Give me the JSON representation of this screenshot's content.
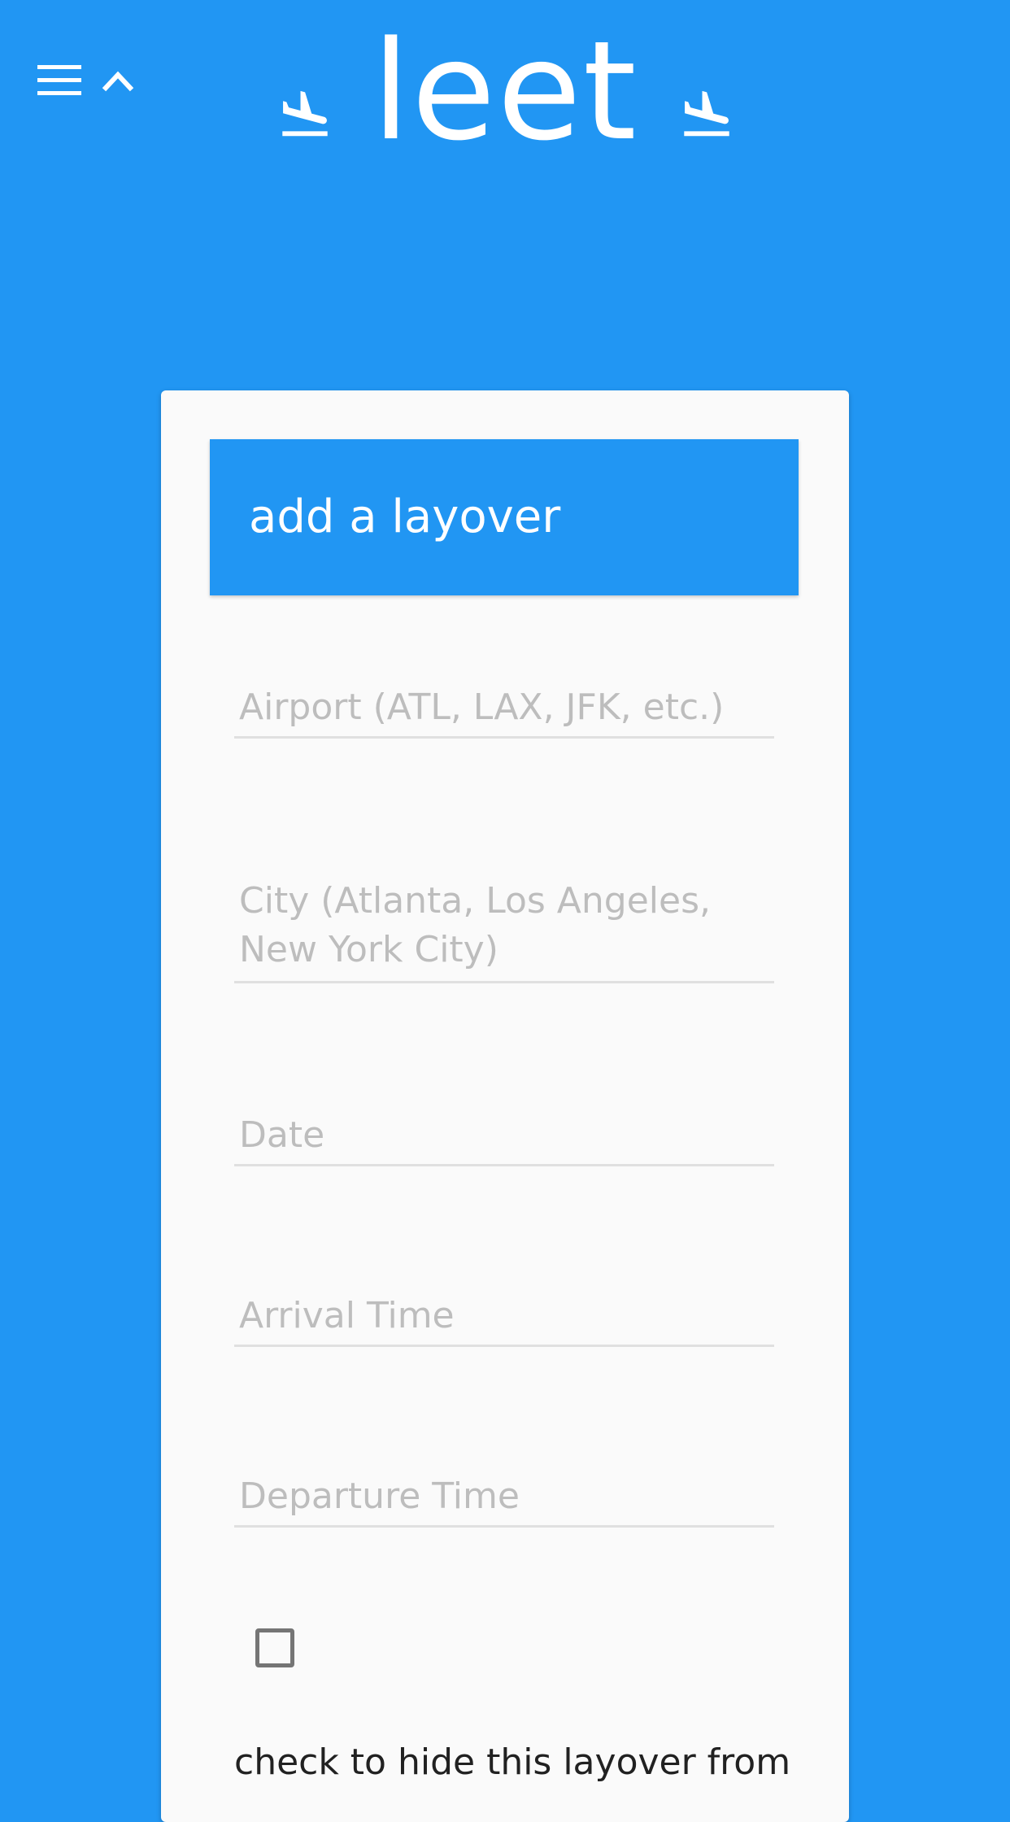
{
  "app": {
    "title": "leet",
    "menu_icon": "menu-icon",
    "collapse_icon": "chevron-up-icon",
    "brand_icons": [
      "flight-land-icon",
      "flight-land-icon"
    ],
    "accent_color": "#2196F3"
  },
  "card": {
    "header_title": "add a layover",
    "fields": {
      "airport": {
        "placeholder": "Airport (ATL, LAX, JFK, etc.)",
        "value": ""
      },
      "city": {
        "placeholder": "City (Atlanta, Los Angeles, New York City)",
        "value": ""
      },
      "date": {
        "placeholder": "Date",
        "value": ""
      },
      "arrival": {
        "placeholder": "Arrival Time",
        "value": ""
      },
      "departure": {
        "placeholder": "Departure Time",
        "value": ""
      }
    },
    "hide_checkbox": {
      "checked": false,
      "label": "check to hide this layover from"
    }
  }
}
